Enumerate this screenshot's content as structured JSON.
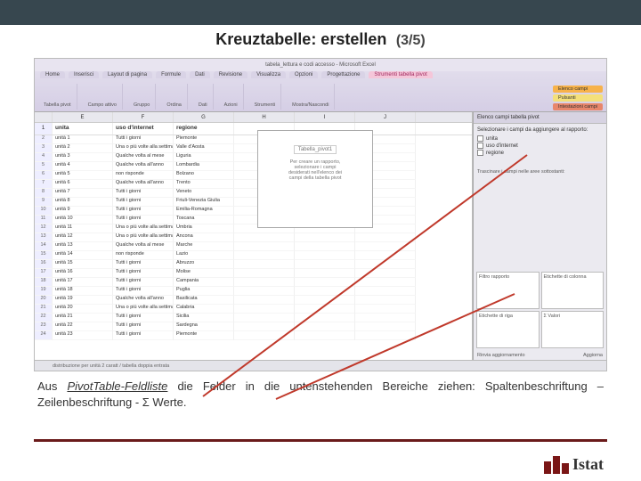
{
  "slide": {
    "title": "Kreuztabelle: erstellen",
    "subtitle": "(3/5)"
  },
  "caption": {
    "prefix": "Aus ",
    "keyword": "PivotTable-Feldliste",
    "rest": " die Felder in die untenstehenden Bereiche ziehen: Spaltenbeschriftung – Zeilenbeschriftung - Σ Werte."
  },
  "excel": {
    "window_title": "tabela_lettura e codi accesso - Microsoft Excel",
    "tabs": [
      "Home",
      "Inserisci",
      "Layout di pagina",
      "Formule",
      "Dati",
      "Revisione",
      "Visualizza",
      "Opzioni",
      "Progettazione"
    ],
    "active_tab": "Strumenti tabella pivot",
    "ribbon_groups": [
      "Tabella pivot",
      "Campo attivo",
      "Gruppo",
      "Ordina",
      "Dati",
      "Azioni",
      "Strumenti",
      "Mostra/Nascondi"
    ],
    "right_buttons": [
      "Elenco campi",
      "Pulsanti",
      "Intestazioni campi"
    ],
    "columns": [
      "",
      "E",
      "F",
      "G",
      "H",
      "I",
      "J"
    ],
    "headers": [
      "unita",
      "uso d'internet",
      "regione"
    ],
    "rows": [
      {
        "n": "2",
        "u": "unità 1",
        "i": "Tutti i giorni",
        "r": "Piemonte"
      },
      {
        "n": "3",
        "u": "unità 2",
        "i": "Una o più volte alla settimana",
        "r": "Valle d'Aosta"
      },
      {
        "n": "4",
        "u": "unità 3",
        "i": "Qualche volta al mese",
        "r": "Liguria"
      },
      {
        "n": "5",
        "u": "unità 4",
        "i": "Qualche volta all'anno",
        "r": "Lombardia"
      },
      {
        "n": "6",
        "u": "unità 5",
        "i": "non risponde",
        "r": "Bolzano"
      },
      {
        "n": "7",
        "u": "unità 6",
        "i": "Qualche volta all'anno",
        "r": "Trento"
      },
      {
        "n": "8",
        "u": "unità 7",
        "i": "Tutti i giorni",
        "r": "Veneto"
      },
      {
        "n": "9",
        "u": "unità 8",
        "i": "Tutti i giorni",
        "r": "Friuli-Venezia Giulia"
      },
      {
        "n": "10",
        "u": "unità 9",
        "i": "Tutti i giorni",
        "r": "Emilia-Romagna"
      },
      {
        "n": "11",
        "u": "unità 10",
        "i": "Tutti i giorni",
        "r": "Toscana"
      },
      {
        "n": "12",
        "u": "unità 11",
        "i": "Una o più volte alla settimana",
        "r": "Umbria"
      },
      {
        "n": "13",
        "u": "unità 12",
        "i": "Una o più volte alla settimana",
        "r": "Ancona"
      },
      {
        "n": "14",
        "u": "unità 13",
        "i": "Qualche volta al mese",
        "r": "Marche"
      },
      {
        "n": "15",
        "u": "unità 14",
        "i": "non risponde",
        "r": "Lazio"
      },
      {
        "n": "16",
        "u": "unità 15",
        "i": "Tutti i giorni",
        "r": "Abruzzo"
      },
      {
        "n": "17",
        "u": "unità 16",
        "i": "Tutti i giorni",
        "r": "Molise"
      },
      {
        "n": "18",
        "u": "unità 17",
        "i": "Tutti i giorni",
        "r": "Campania"
      },
      {
        "n": "19",
        "u": "unità 18",
        "i": "Tutti i giorni",
        "r": "Puglia"
      },
      {
        "n": "20",
        "u": "unità 19",
        "i": "Qualche volta all'anno",
        "r": "Basilicata"
      },
      {
        "n": "21",
        "u": "unità 20",
        "i": "Una o più volte alla settimana",
        "r": "Calabria"
      },
      {
        "n": "22",
        "u": "unità 21",
        "i": "Tutti i giorni",
        "r": "Sicilia"
      },
      {
        "n": "23",
        "u": "unità 22",
        "i": "Tutti i giorni",
        "r": "Sardegna"
      },
      {
        "n": "24",
        "u": "unità 23",
        "i": "Tutti i giorni",
        "r": "Piemonte"
      }
    ],
    "pivot_placeholder": {
      "title": "Tabella_pivot1",
      "text1": "Per creare un rapporto,",
      "text2": "selezionare i campi",
      "text3": "desiderati nell'elenco dei",
      "text4": "campi della tabella pivot"
    },
    "sheet_tabs": "distribuzione per unità 2 caratt / tabella doppia entrata",
    "field_pane": {
      "header": "Elenco campi tabella pivot",
      "instruction": "Selezionare i campi da aggiungere al rapporto:",
      "fields": [
        "unita",
        "uso d'internet",
        "regione"
      ],
      "drag_label": "Trascinare i campi nelle aree sottostanti:",
      "zones": [
        "Filtro rapporto",
        "Etichette di colonna",
        "Etichette di riga",
        "Σ Valori"
      ],
      "footer_left": "Rinvia aggiornamento",
      "footer_right": "Aggiorna"
    }
  },
  "logo_text": "Istat"
}
